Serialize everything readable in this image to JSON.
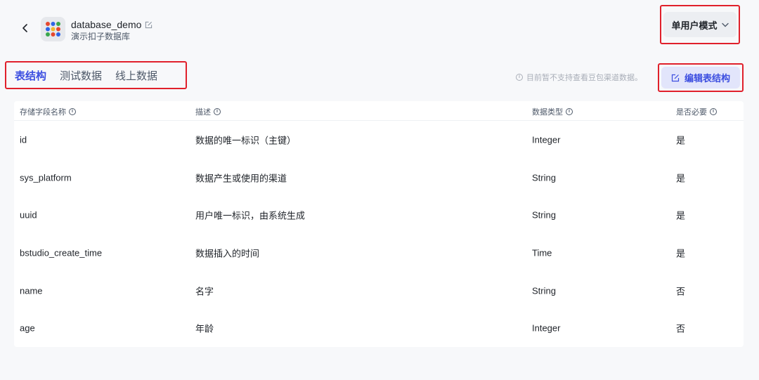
{
  "header": {
    "back_icon": "chevron-left-icon",
    "app_icon": "app-dots-icon",
    "app_title": "database_demo",
    "edit_title_icon": "edit-icon",
    "app_subtitle": "演示扣子数据库",
    "mode_select": {
      "value": "单用户模式",
      "icon": "chevron-down-icon"
    }
  },
  "tabs": [
    {
      "label": "表结构",
      "active": true
    },
    {
      "label": "测试数据",
      "active": false
    },
    {
      "label": "线上数据",
      "active": false
    }
  ],
  "notice": {
    "icon": "info-icon",
    "text": "目前暂不支持查看豆包渠道数据。"
  },
  "edit_button": {
    "icon": "edit-icon",
    "label": "编辑表结构"
  },
  "table": {
    "columns": [
      {
        "label": "存储字段名称"
      },
      {
        "label": "描述"
      },
      {
        "label": "数据类型"
      },
      {
        "label": "是否必要"
      }
    ],
    "rows": [
      {
        "name": "id",
        "desc": "数据的唯一标识（主键）",
        "type": "Integer",
        "required": "是"
      },
      {
        "name": "sys_platform",
        "desc": "数据产生或使用的渠道",
        "type": "String",
        "required": "是"
      },
      {
        "name": "uuid",
        "desc": "用户唯一标识，由系统生成",
        "type": "String",
        "required": "是"
      },
      {
        "name": "bstudio_create_time",
        "desc": "数据插入的时间",
        "type": "Time",
        "required": "是"
      },
      {
        "name": "name",
        "desc": "名字",
        "type": "String",
        "required": "否"
      },
      {
        "name": "age",
        "desc": "年龄",
        "type": "Integer",
        "required": "否"
      }
    ]
  },
  "colors": {
    "accent": "#3c4ee0",
    "highlight_border": "#e0202b"
  }
}
